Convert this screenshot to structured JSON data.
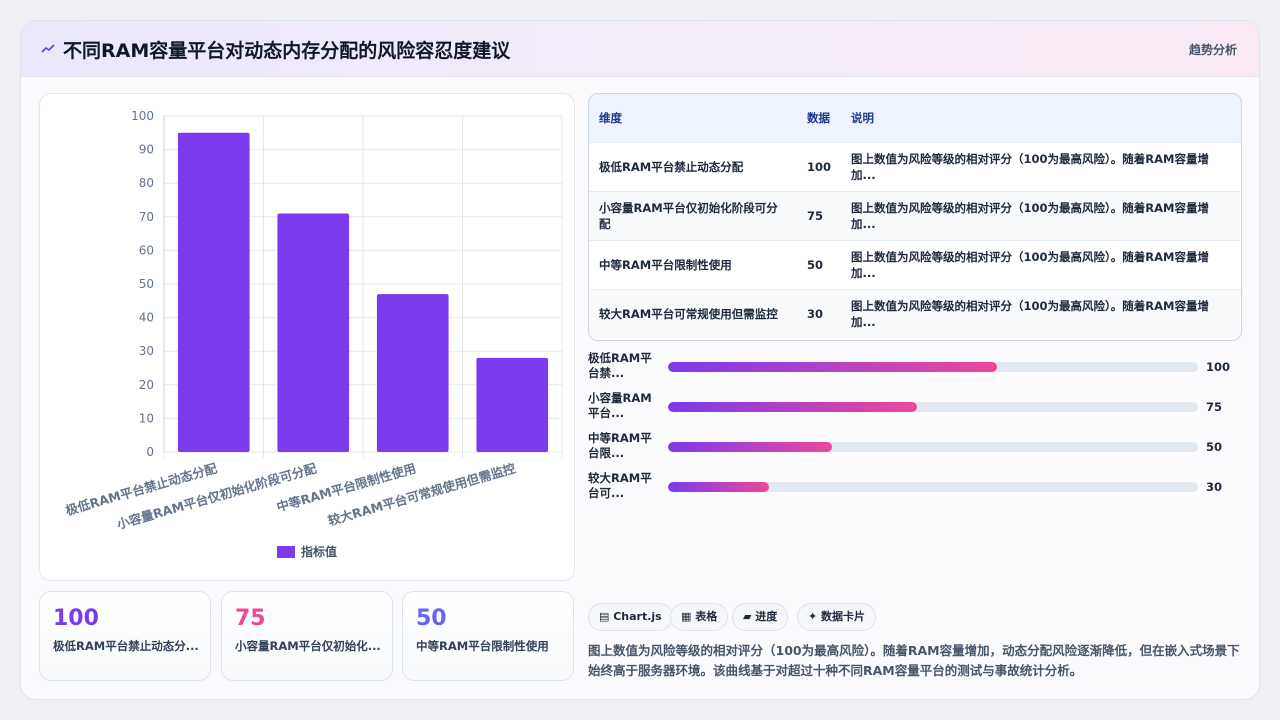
{
  "header": {
    "title": "不同RAM容量平台对动态内存分配的风险容忍度建议",
    "tag": "趋势分析",
    "icon": "trend-icon"
  },
  "chart_data": {
    "type": "bar",
    "categories": [
      "极低RAM平台禁止动态分配",
      "小容量RAM平台仅初始化阶段可分配",
      "中等RAM平台限制性使用",
      "较大RAM平台可常规使用但需监控"
    ],
    "series": [
      {
        "name": "指标值",
        "values": [
          95,
          71,
          47,
          28
        ],
        "color": "#7c3aed"
      }
    ],
    "ylim": [
      0,
      100
    ],
    "yticks": [
      0,
      10,
      20,
      30,
      40,
      50,
      60,
      70,
      80,
      90,
      100
    ],
    "grid": true,
    "legend": "bottom"
  },
  "table": {
    "headers": [
      "维度",
      "数据",
      "说明"
    ],
    "rows": [
      [
        "极低RAM平台禁止动态分配",
        "100",
        "图上数值为风险等级的相对评分（100为最高风险）。随着RAM容量增加..."
      ],
      [
        "小容量RAM平台仅初始化阶段可分配",
        "75",
        "图上数值为风险等级的相对评分（100为最高风险）。随着RAM容量增加..."
      ],
      [
        "中等RAM平台限制性使用",
        "50",
        "图上数值为风险等级的相对评分（100为最高风险）。随着RAM容量增加..."
      ],
      [
        "较大RAM平台可常规使用但需监控",
        "30",
        "图上数值为风险等级的相对评分（100为最高风险）。随着RAM容量增加..."
      ]
    ]
  },
  "progress": [
    {
      "label": "极低RAM平台禁...",
      "value": 100,
      "fill": 0.62
    },
    {
      "label": "小容量RAM平台...",
      "value": 75,
      "fill": 0.47
    },
    {
      "label": "中等RAM平台限...",
      "value": 50,
      "fill": 0.31
    },
    {
      "label": "较大RAM平台可...",
      "value": 30,
      "fill": 0.19
    }
  ],
  "kpis": [
    {
      "value": "100",
      "label": "极低RAM平台禁止动态分...",
      "color": "#7c3aed"
    },
    {
      "value": "75",
      "label": "小容量RAM平台仅初始化...",
      "color": "#ec4899"
    },
    {
      "value": "50",
      "label": "中等RAM平台限制性使用",
      "color": "#6366f1"
    }
  ],
  "chips": [
    "▤ Chart.js",
    "▦ 表格",
    "▰ 进度",
    "✦ 数据卡片"
  ],
  "description": "图上数值为风险等级的相对评分（100为最高风险）。随着RAM容量增加，动态分配风险逐渐降低，但在嵌入式场景下始终高于服务器环境。该曲线基于对超过十种不同RAM容量平台的测试与事故统计分析。"
}
